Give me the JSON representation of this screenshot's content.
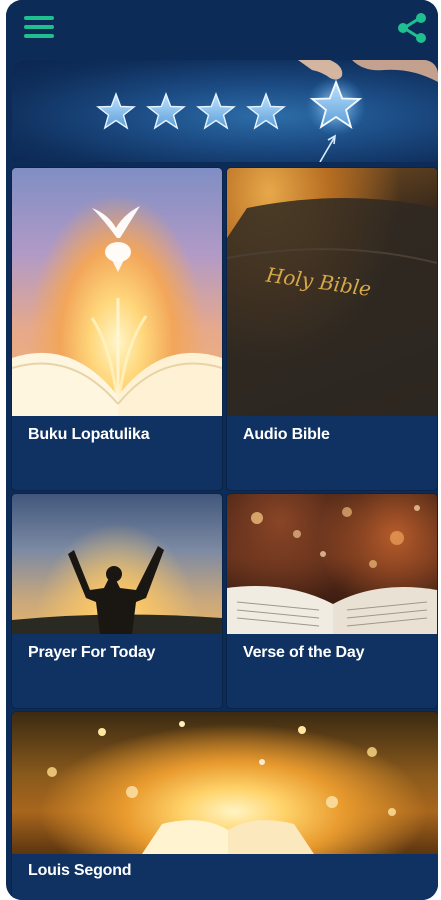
{
  "toolbar": {
    "menu_icon": "hamburger-menu-icon",
    "share_icon": "share-icon"
  },
  "rate_banner": {
    "stars": 5,
    "icon": "star-icon"
  },
  "cards": [
    {
      "label": "Buku Lopatulika",
      "image": "dove-over-open-bible"
    },
    {
      "label": "Audio Bible",
      "image": "holy-bible-cover"
    },
    {
      "label": "Prayer For Today",
      "image": "person-raising-arms-sunset"
    },
    {
      "label": "Verse of the Day",
      "image": "open-bible-bokeh"
    },
    {
      "label": "Louis Segond",
      "image": "glowing-open-book"
    }
  ],
  "colors": {
    "background": "#0d2b57",
    "card": "#0f3263",
    "accent": "#1fbf8f",
    "text": "#ffffff"
  }
}
